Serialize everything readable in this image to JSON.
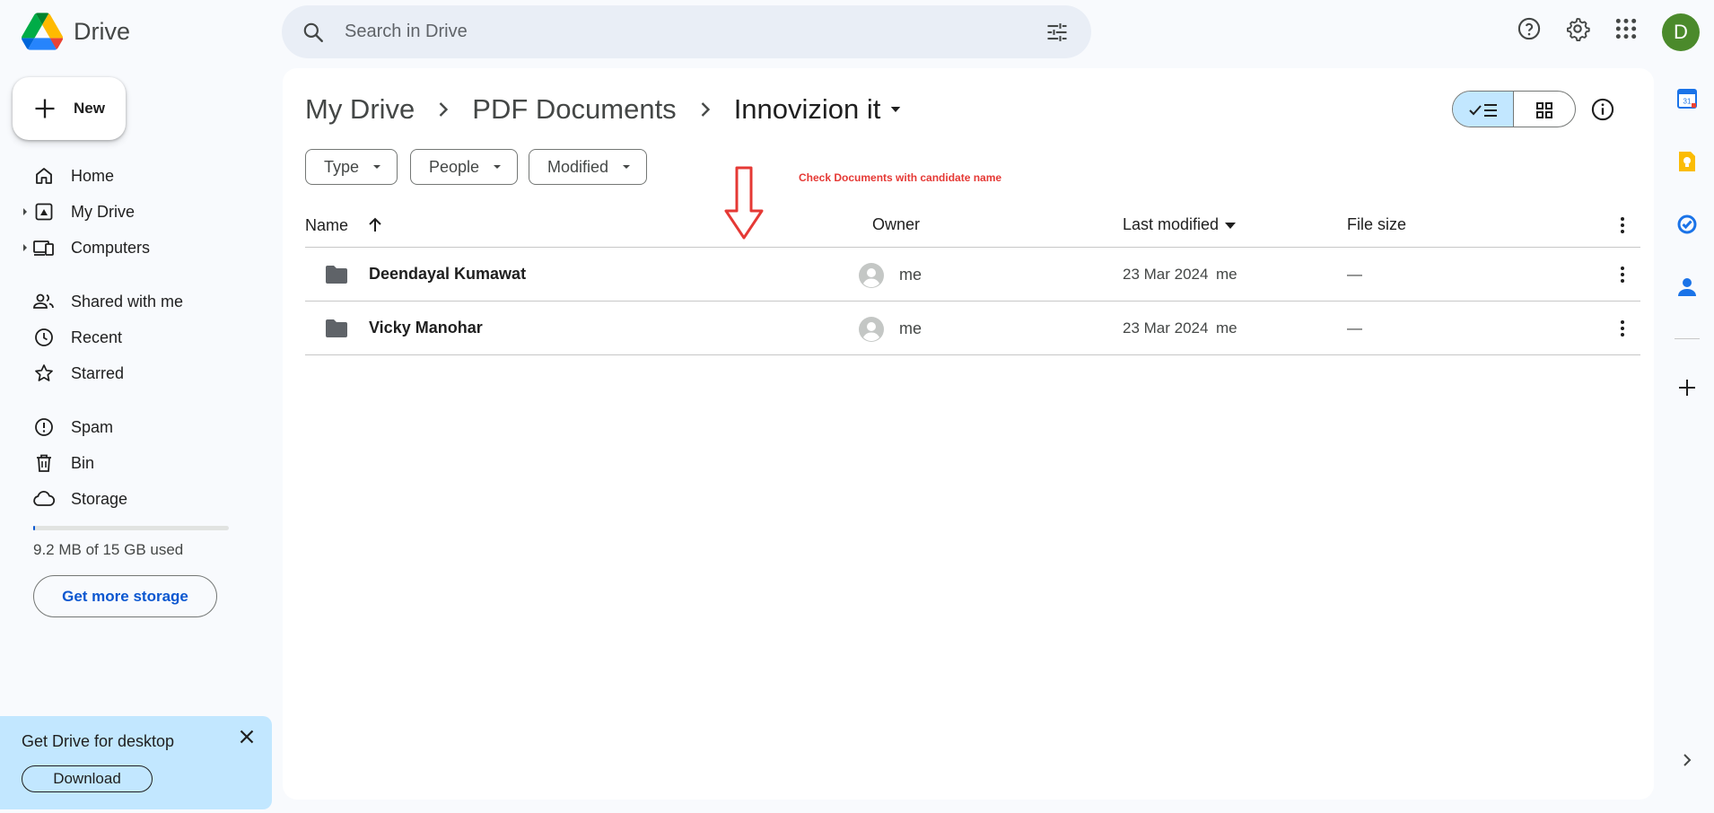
{
  "app": {
    "name": "Drive"
  },
  "search": {
    "placeholder": "Search in Drive"
  },
  "user": {
    "avatar_letter": "D",
    "avatar_color": "#4b8a2b"
  },
  "new_button": {
    "label": "New"
  },
  "sidebar": {
    "items": [
      {
        "label": "Home",
        "icon": "home-icon"
      },
      {
        "label": "My Drive",
        "icon": "drive-icon"
      },
      {
        "label": "Computers",
        "icon": "computers-icon"
      },
      {
        "label": "Shared with me",
        "icon": "people-icon"
      },
      {
        "label": "Recent",
        "icon": "clock-icon"
      },
      {
        "label": "Starred",
        "icon": "star-icon"
      },
      {
        "label": "Spam",
        "icon": "spam-icon"
      },
      {
        "label": "Bin",
        "icon": "trash-icon"
      },
      {
        "label": "Storage",
        "icon": "cloud-icon"
      }
    ],
    "storage_text": "9.2 MB of 15 GB used",
    "storage_fraction": 0.0006,
    "get_more_storage": "Get more storage"
  },
  "desktop_promo": {
    "title": "Get Drive for desktop",
    "download_label": "Download"
  },
  "breadcrumb": {
    "root": "My Drive",
    "parent": "PDF Documents",
    "current": "Innovizion it"
  },
  "filters": {
    "type": "Type",
    "people": "People",
    "modified": "Modified"
  },
  "annotation": {
    "text": "Check Documents with candidate name",
    "color": "#e53935"
  },
  "table": {
    "headers": {
      "name": "Name",
      "owner": "Owner",
      "last_modified": "Last modified",
      "file_size": "File size"
    },
    "rows": [
      {
        "name": "Deendayal Kumawat",
        "owner": "me",
        "modified": "23 Mar 2024",
        "modified_by": "me",
        "size": "—"
      },
      {
        "name": "Vicky Manohar",
        "owner": "me",
        "modified": "23 Mar 2024",
        "modified_by": "me",
        "size": "—"
      }
    ]
  },
  "colors": {
    "accent": "#0b57d0",
    "selected": "#c2e7ff",
    "background": "#f8fafd"
  }
}
